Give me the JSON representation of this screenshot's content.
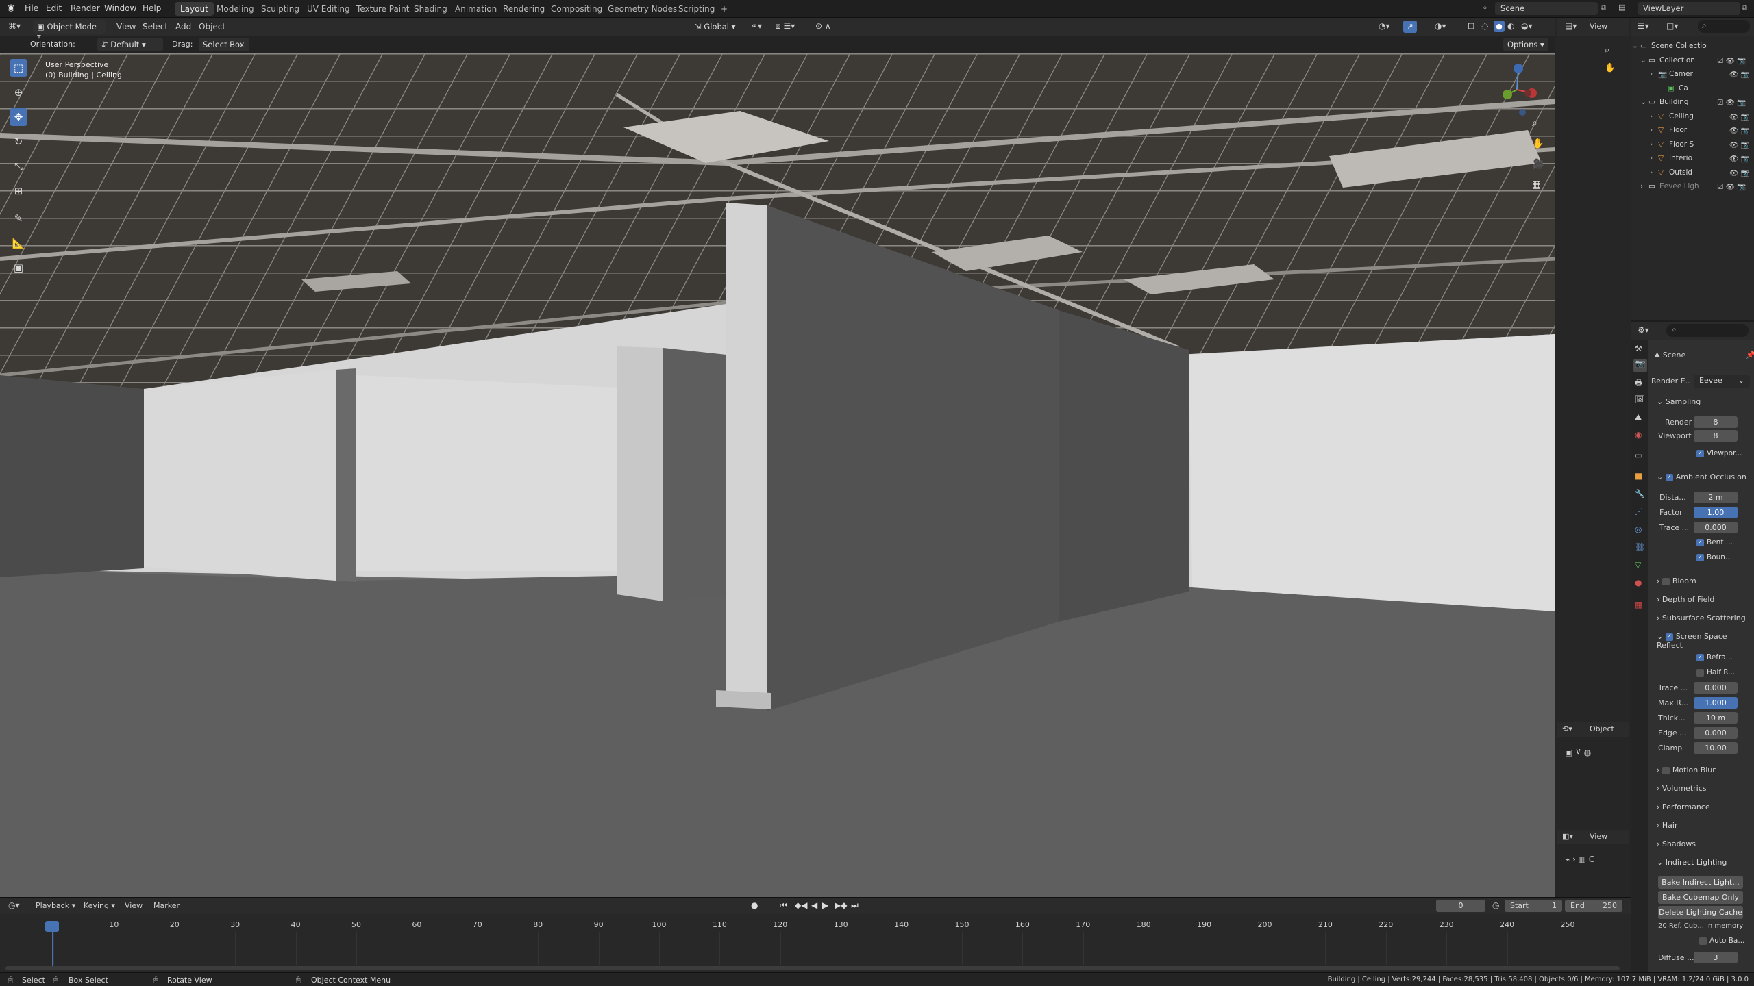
{
  "topbar": {
    "menus": [
      "File",
      "Edit",
      "Render",
      "Window",
      "Help"
    ],
    "workspaces": [
      "Layout",
      "Modeling",
      "Sculpting",
      "UV Editing",
      "Texture Paint",
      "Shading",
      "Animation",
      "Rendering",
      "Compositing",
      "Geometry Nodes",
      "Scripting"
    ],
    "active_workspace": "Layout",
    "add_tab": "+",
    "scene": "Scene",
    "view_layer": "ViewLayer"
  },
  "viewport_header": {
    "mode": "Object Mode",
    "menus": [
      "View",
      "Select",
      "Add",
      "Object"
    ],
    "transform": "Global",
    "orientation_label": "Orientation:",
    "orientation_value": "Default",
    "drag_label": "Drag:",
    "drag_value": "Select Box",
    "options": "Options"
  },
  "viewport": {
    "perspective": "User Perspective",
    "context": "(0) Building | Ceiling"
  },
  "side_strip": {
    "view1": "View",
    "view2": "View",
    "object": "Object"
  },
  "outliner": {
    "rows": [
      {
        "label": "Scene Collectio",
        "icon": "collection-icon"
      },
      {
        "label": "Collection",
        "icon": "collection-icon"
      },
      {
        "label": "Camer",
        "icon": "camera-icon"
      },
      {
        "label": "Ca",
        "icon": "camera-data-icon"
      },
      {
        "label": "Building",
        "icon": "collection-icon"
      },
      {
        "label": "Ceiling",
        "icon": "mesh-icon"
      },
      {
        "label": "Floor",
        "icon": "mesh-icon"
      },
      {
        "label": "Floor S",
        "icon": "mesh-icon"
      },
      {
        "label": "Interio",
        "icon": "mesh-icon"
      },
      {
        "label": "Outsid",
        "icon": "mesh-icon"
      },
      {
        "label": "Eevee Ligh",
        "icon": "collection-icon"
      }
    ]
  },
  "properties": {
    "scene": "Scene",
    "render_engine_label": "Render E...",
    "render_engine_value": "Eevee",
    "sampling": "Sampling",
    "render_label": "Render",
    "render_value": "8",
    "viewport_label": "Viewport",
    "viewport_value": "8",
    "viewport_denoise": "Viewpor...",
    "ambient_occlusion": "Ambient Occlusion",
    "ao_distance_label": "Dista...",
    "ao_distance_value": "2 m",
    "ao_factor_label": "Factor",
    "ao_factor_value": "1.00",
    "ao_trace_label": "Trace ...",
    "ao_trace_value": "0.000",
    "ao_bent": "Bent ...",
    "ao_bounce": "Boun...",
    "bloom": "Bloom",
    "depth_of_field": "Depth of Field",
    "subsurface": "Subsurface Scattering",
    "ssr": "Screen Space Reflect",
    "ssr_refraction": "Refra...",
    "ssr_half": "Half R...",
    "ssr_trace_label": "Trace ...",
    "ssr_trace_value": "0.000",
    "ssr_max_label": "Max R...",
    "ssr_max_value": "1.000",
    "ssr_thick_label": "Thick...",
    "ssr_thick_value": "10 m",
    "ssr_edge_label": "Edge ...",
    "ssr_edge_value": "0.000",
    "ssr_clamp_label": "Clamp",
    "ssr_clamp_value": "10.00",
    "motion_blur": "Motion Blur",
    "volumetrics": "Volumetrics",
    "performance": "Performance",
    "hair": "Hair",
    "shadows": "Shadows",
    "indirect_lighting": "Indirect Lighting",
    "bake_indirect": "Bake Indirect Light...",
    "bake_cubemap": "Bake Cubemap Only",
    "delete_cache": "Delete Lighting Cache",
    "cache_info": "20 Ref. Cub... in memory",
    "auto_bake": "Auto Ba...",
    "diffuse_label": "Diffuse ...",
    "diffuse_value": "3"
  },
  "timeline": {
    "menus": [
      "Playback",
      "Keying",
      "View",
      "Marker"
    ],
    "current_frame": "0",
    "start_label": "Start",
    "start_value": "1",
    "end_label": "End",
    "end_value": "250",
    "ticks": [
      "0",
      "10",
      "20",
      "30",
      "40",
      "50",
      "60",
      "70",
      "80",
      "90",
      "100",
      "110",
      "120",
      "130",
      "140",
      "150",
      "160",
      "170",
      "180",
      "190",
      "200",
      "210",
      "220",
      "230",
      "240",
      "250"
    ]
  },
  "statusbar": {
    "select": "Select",
    "box_select": "Box Select",
    "rotate": "Rotate View",
    "context_menu": "Object Context Menu",
    "stats": "Building | Ceiling | Verts:29,244 | Faces:28,535 | Tris:58,408 | Objects:0/6 | Memory: 107.7 MiB | VRAM: 1.2/24.0 GiB | 3.0.0"
  },
  "colors": {
    "accent": "#4772b3",
    "header": "#2b2b2b",
    "panel": "#282828",
    "viewport": "#5a5a5a"
  }
}
